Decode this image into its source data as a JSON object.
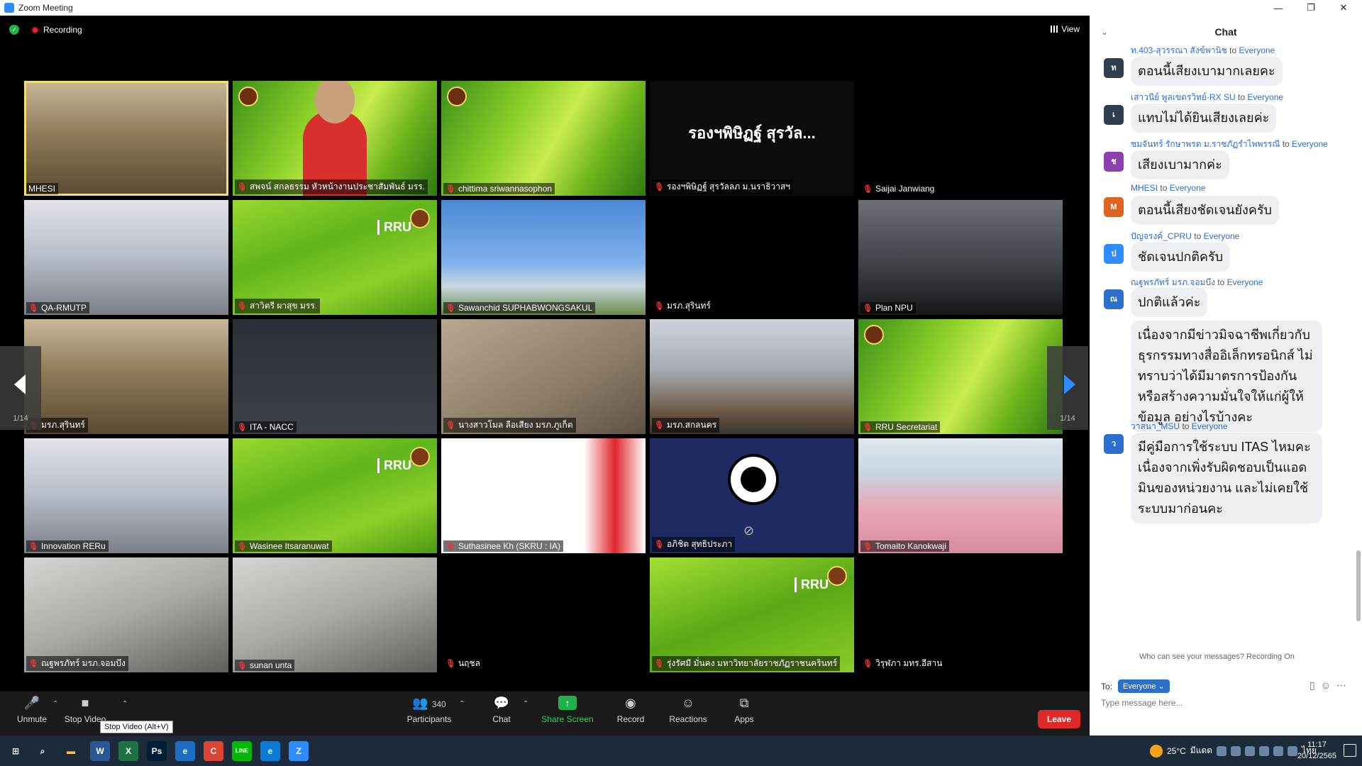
{
  "window": {
    "title": "Zoom Meeting",
    "minimize": "—",
    "restore": "❐",
    "close": "✕"
  },
  "topbar": {
    "recording_label": "Recording",
    "view_label": "View"
  },
  "pager": {
    "left_label": "1/14",
    "right_label": "1/14"
  },
  "tiles": [
    {
      "name": "MHESI",
      "muted": false,
      "bg": "bg-room2",
      "active": true
    },
    {
      "name": "สพจน์ สกลธรรม หัวหน้างานประชาสัมพันธ์ มรร.",
      "muted": true,
      "bg": "bg-green",
      "person": true
    },
    {
      "name": "chittima sriwannasophon",
      "muted": true,
      "bg": "bg-green"
    },
    {
      "name": "รองฯพิษิฏฐ์ สุรวัลลภ ม.นราธิวาสฯ",
      "muted": true,
      "bg": "bg-dark",
      "overlay": "รองฯพิษิฏฐ์ สุรวัล..."
    },
    {
      "name": "Saijai Janwiang",
      "muted": true,
      "bg": "bg-black"
    },
    {
      "name": "QA-RMUTP",
      "muted": true,
      "bg": "bg-office"
    },
    {
      "name": "สาวิตรี ผาสุข มรร.",
      "muted": true,
      "bg": "bg-rru",
      "rru": "RRU"
    },
    {
      "name": "Sawanchid SUPHABWONGSAKUL",
      "muted": true,
      "bg": "bg-sky"
    },
    {
      "name": "มรภ.สุรินทร์",
      "muted": true,
      "bg": "bg-black"
    },
    {
      "name": "Plan NPU",
      "muted": true,
      "bg": "bg-gray"
    },
    {
      "name": "มรภ.สุรินทร์",
      "muted": true,
      "bg": "bg-room2"
    },
    {
      "name": "ITA - NACC",
      "muted": true,
      "bg": "bg-person"
    },
    {
      "name": "นางสาวโมล ลือเสียง มรภ.ภูเก็ต",
      "muted": true,
      "bg": "bg-wall"
    },
    {
      "name": "มรภ.สกลนคร",
      "muted": true,
      "bg": "bg-room"
    },
    {
      "name": "RRU Secretariat",
      "muted": true,
      "bg": "bg-green"
    },
    {
      "name": "Innovation RERu",
      "muted": true,
      "bg": "bg-office"
    },
    {
      "name": "Wasinee Itsaranuwat",
      "muted": true,
      "bg": "bg-rru",
      "rru": "RRU"
    },
    {
      "name": "Suthasinee Kh (SKRU : IA)",
      "muted": true,
      "bg": "bg-skru"
    },
    {
      "name": "อภิชิต สุทธิประภา",
      "muted": true,
      "bg": "bg-obs",
      "obs": true
    },
    {
      "name": "Tomaito Kanokwaji",
      "muted": true,
      "bg": "bg-pink"
    },
    {
      "name": "ณฐพรภัทร์ มรภ.จอมบึง",
      "muted": true,
      "bg": "bg-desk"
    },
    {
      "name": "sunan unta",
      "muted": true,
      "bg": "bg-desk"
    },
    {
      "name": "นฤชล",
      "muted": true,
      "bg": "bg-black"
    },
    {
      "name": "รุ่งรัศมี มั่นคง มหาวิทยาลัยราชภัฏราชนครินทร์",
      "muted": true,
      "bg": "bg-rrulogo",
      "rru": "RRU"
    },
    {
      "name": "วิรุฬภา มทร.อีสาน",
      "muted": true,
      "bg": "bg-black"
    }
  ],
  "toolbar": {
    "unmute": "Unmute",
    "stop_video": "Stop Video",
    "tooltip": "Stop Video (Alt+V)",
    "participants": "Participants",
    "participants_count": "340",
    "chat": "Chat",
    "share_screen": "Share Screen",
    "record": "Record",
    "reactions": "Reactions",
    "apps": "Apps",
    "leave": "Leave"
  },
  "chat": {
    "title": "Chat",
    "to_word": "to",
    "messages": [
      {
        "sender": "ท.403-สุวรรณา สังข์พานิช",
        "to": "Everyone",
        "initial": "ท",
        "color": "#2f3e4e",
        "text": "ตอนนี้เสียงเบามากเลยคะ"
      },
      {
        "sender": "เสาวนีย์ พูลเขตรวิทย์-RX SU",
        "to": "Everyone",
        "initial": "เ",
        "color": "#2f3e4e",
        "text": "แทบไม่ได้ยินเสียงเลยค่ะ"
      },
      {
        "sender": "ชมจันทร์ รักษาพรต ม.ราชภัฏรำไพพรรณี",
        "to": "Everyone",
        "initial": "ช",
        "color": "#8e3fae",
        "text": "เสียงเบามากค่ะ"
      },
      {
        "sender": "MHESI",
        "to": "Everyone",
        "initial": "M",
        "color": "#e0641f",
        "text": "ตอนนี้เสียงชัดเจนยังครับ"
      },
      {
        "sender": "ปัญจรงค์_CPRU",
        "to": "Everyone",
        "initial": "ป",
        "color": "#2d8cff",
        "text": "ชัดเจนปกติครับ"
      },
      {
        "sender": "ณฐพรภัทร์ มรภ.จอมบึง",
        "to": "Everyone",
        "initial": "ณ",
        "color": "#2d6fcc",
        "text": "ปกติแล้วค่ะ",
        "text2": "เนื่องจากมีข่าวมิจฉาชีพเกี่ยวกับธุรกรรมทางสื่ออิเล็กทรอนิกส์ ไม่ทราบว่าได้มีมาตรการป้องกันหรือสร้างความมั่นใจให้แก่ผู้ให้ข้อมูล อย่างไรบ้างคะ"
      },
      {
        "sender": "วาสนา_MSU",
        "to": "Everyone",
        "initial": "ว",
        "color": "#2d6fcc",
        "text": "มีคู่มือการใช้ระบบ ITAS ไหมคะ เนื่องจากเพิ่งรับผิดชอบเป็นแอดมินของหน่วยงาน และไม่เคยใช้ระบบมาก่อนคะ"
      }
    ],
    "who_can_see": "Who can see your messages? Recording On",
    "to_label": "To:",
    "to_value": "Everyone ⌄",
    "input_placeholder": "Type message here..."
  },
  "taskbar": {
    "temperature": "25°C",
    "weather": "มีแดด",
    "lang": "ไทย",
    "time": "11:17",
    "date": "20/12/2565",
    "apps": [
      "W",
      "X",
      "Ps",
      "e",
      "C",
      "LINE",
      "e",
      "Z"
    ]
  }
}
